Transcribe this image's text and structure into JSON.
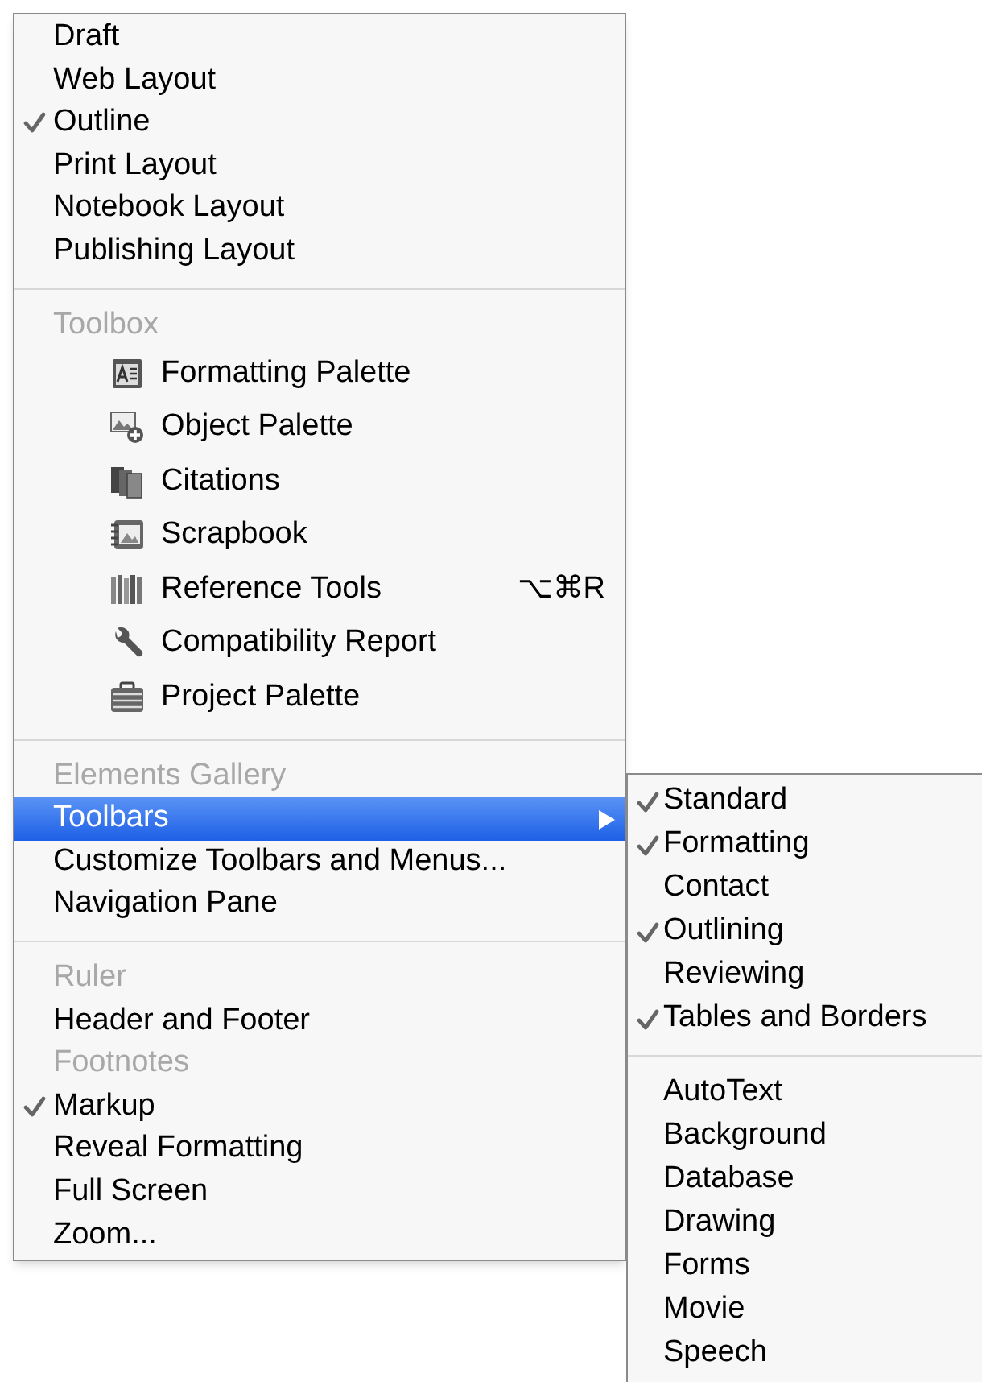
{
  "main_menu": {
    "sections": [
      {
        "items": [
          {
            "kind": "item",
            "label": "Draft",
            "checked": false,
            "disabled": false,
            "selected": false,
            "submenu": false
          },
          {
            "kind": "item",
            "label": "Web Layout",
            "checked": false,
            "disabled": false,
            "selected": false,
            "submenu": false
          },
          {
            "kind": "item",
            "label": "Outline",
            "checked": true,
            "disabled": false,
            "selected": false,
            "submenu": false
          },
          {
            "kind": "item",
            "label": "Print Layout",
            "checked": false,
            "disabled": false,
            "selected": false,
            "submenu": false
          },
          {
            "kind": "item",
            "label": "Notebook Layout",
            "checked": false,
            "disabled": false,
            "selected": false,
            "submenu": false
          },
          {
            "kind": "item",
            "label": "Publishing Layout",
            "checked": false,
            "disabled": false,
            "selected": false,
            "submenu": false
          }
        ]
      },
      {
        "items": [
          {
            "kind": "item",
            "label": "Toolbox",
            "checked": false,
            "disabled": true,
            "selected": false,
            "submenu": false
          },
          {
            "kind": "tool",
            "label": "Formatting Palette",
            "checked": false,
            "disabled": false,
            "selected": false,
            "submenu": false
          },
          {
            "kind": "tool",
            "label": "Object Palette",
            "checked": false,
            "disabled": false,
            "selected": false,
            "submenu": false
          },
          {
            "kind": "tool",
            "label": "Citations",
            "checked": false,
            "disabled": false,
            "selected": false,
            "submenu": false
          },
          {
            "kind": "tool",
            "label": "Scrapbook",
            "checked": false,
            "disabled": false,
            "selected": false,
            "submenu": false
          },
          {
            "kind": "tool",
            "label": "Reference Tools",
            "shortcut": "⌥⌘R",
            "checked": false,
            "disabled": false,
            "selected": false,
            "submenu": false
          },
          {
            "kind": "tool",
            "label": "Compatibility Report",
            "checked": false,
            "disabled": false,
            "selected": false,
            "submenu": false
          },
          {
            "kind": "tool",
            "label": "Project Palette",
            "checked": false,
            "disabled": false,
            "selected": false,
            "submenu": false
          }
        ]
      },
      {
        "items": [
          {
            "kind": "item",
            "label": "Elements Gallery",
            "checked": false,
            "disabled": true,
            "selected": false,
            "submenu": false
          },
          {
            "kind": "item",
            "label": "Toolbars",
            "checked": false,
            "disabled": false,
            "selected": true,
            "submenu": true
          },
          {
            "kind": "item",
            "label": "Customize Toolbars and Menus...",
            "checked": false,
            "disabled": false,
            "selected": false,
            "submenu": false
          },
          {
            "kind": "item",
            "label": "Navigation Pane",
            "checked": false,
            "disabled": false,
            "selected": false,
            "submenu": false
          }
        ]
      },
      {
        "items": [
          {
            "kind": "item",
            "label": "Ruler",
            "checked": false,
            "disabled": true,
            "selected": false,
            "submenu": false
          },
          {
            "kind": "item",
            "label": "Header and Footer",
            "checked": false,
            "disabled": false,
            "selected": false,
            "submenu": false
          },
          {
            "kind": "item",
            "label": "Footnotes",
            "checked": false,
            "disabled": true,
            "selected": false,
            "submenu": false
          },
          {
            "kind": "item",
            "label": "Markup",
            "checked": true,
            "disabled": false,
            "selected": false,
            "submenu": false
          },
          {
            "kind": "item",
            "label": "Reveal Formatting",
            "checked": false,
            "disabled": false,
            "selected": false,
            "submenu": false
          },
          {
            "kind": "item",
            "label": "Full Screen",
            "checked": false,
            "disabled": false,
            "selected": false,
            "submenu": false
          },
          {
            "kind": "item",
            "label": "Zoom...",
            "checked": false,
            "disabled": false,
            "selected": false,
            "submenu": false
          }
        ]
      }
    ]
  },
  "toolbars_submenu": {
    "sections": [
      {
        "items": [
          {
            "label": "Standard",
            "checked": true
          },
          {
            "label": "Formatting",
            "checked": true
          },
          {
            "label": "Contact",
            "checked": false
          },
          {
            "label": "Outlining",
            "checked": true
          },
          {
            "label": "Reviewing",
            "checked": false
          },
          {
            "label": "Tables and Borders",
            "checked": true
          }
        ]
      },
      {
        "items": [
          {
            "label": "AutoText",
            "checked": false
          },
          {
            "label": "Background",
            "checked": false
          },
          {
            "label": "Database",
            "checked": false
          },
          {
            "label": "Drawing",
            "checked": false
          },
          {
            "label": "Forms",
            "checked": false
          },
          {
            "label": "Movie",
            "checked": false
          },
          {
            "label": "Speech",
            "checked": false
          }
        ]
      }
    ]
  }
}
